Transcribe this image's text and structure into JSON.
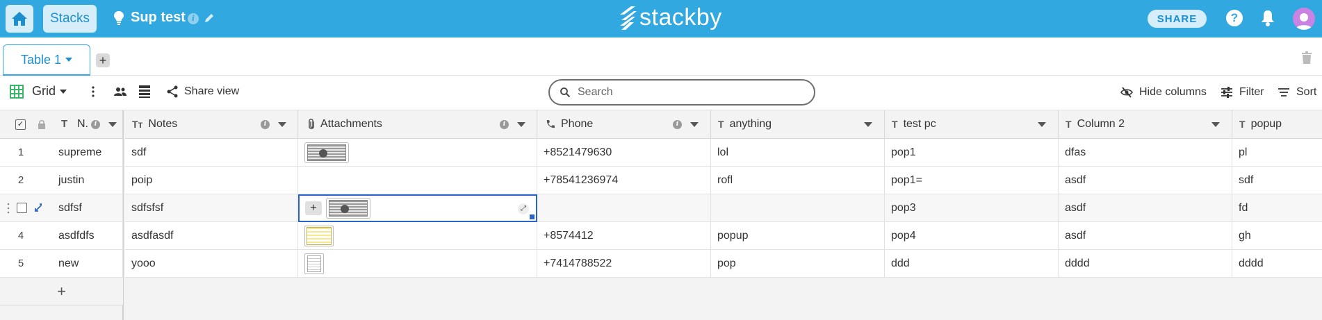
{
  "topbar": {
    "stacks_label": "Stacks",
    "stack_title": "Sup test",
    "logo_text": "stackby",
    "share_label": "SHARE",
    "help_label": "?",
    "brand_color": "#32a8e0"
  },
  "tabs": {
    "active_tab_label": "Table 1",
    "add_tab_label": "+"
  },
  "toolbar": {
    "view_label": "Grid",
    "share_view_label": "Share view",
    "search_placeholder": "Search",
    "hide_columns_label": "Hide columns",
    "filter_label": "Filter",
    "sort_label": "Sort"
  },
  "columns": [
    {
      "key": "name",
      "label": "N.",
      "type_icon": "text-icon"
    },
    {
      "key": "notes",
      "label": "Notes",
      "type_icon": "long-text-icon"
    },
    {
      "key": "attachments",
      "label": "Attachments",
      "type_icon": "paperclip-icon"
    },
    {
      "key": "phone",
      "label": "Phone",
      "type_icon": "phone-icon"
    },
    {
      "key": "anything",
      "label": "anything",
      "type_icon": "text-icon"
    },
    {
      "key": "test_pc",
      "label": "test pc",
      "type_icon": "text-icon"
    },
    {
      "key": "column2",
      "label": "Column 2",
      "type_icon": "text-icon"
    },
    {
      "key": "popup",
      "label": "popup",
      "type_icon": "text-icon"
    }
  ],
  "rows": [
    {
      "num": "1",
      "name": "supreme",
      "notes": "sdf",
      "attachment": "image",
      "phone": "+8521479630",
      "anything": "lol",
      "test_pc": "pop1",
      "column2": "dfas",
      "popup": "pl"
    },
    {
      "num": "2",
      "name": "justin",
      "notes": "poip",
      "attachment": "",
      "phone": "+78541236974",
      "anything": "rofl",
      "test_pc": "pop1=",
      "column2": "asdf",
      "popup": "sdf"
    },
    {
      "num": "3",
      "name": "sdfsf",
      "notes": "sdfsfsf",
      "attachment": "image",
      "phone": "",
      "anything": "",
      "test_pc": "pop3",
      "column2": "asdf",
      "popup": "fd"
    },
    {
      "num": "4",
      "name": "asdfdfs",
      "notes": "asdfasdf",
      "attachment": "sheet",
      "phone": "+8574412",
      "anything": "popup",
      "test_pc": "pop4",
      "column2": "asdf",
      "popup": "gh"
    },
    {
      "num": "5",
      "name": "new",
      "notes": "yooo",
      "attachment": "doc",
      "phone": "+7414788522",
      "anything": "pop",
      "test_pc": "ddd",
      "column2": "dddd",
      "popup": "dddd"
    }
  ],
  "add_row_label": "+"
}
